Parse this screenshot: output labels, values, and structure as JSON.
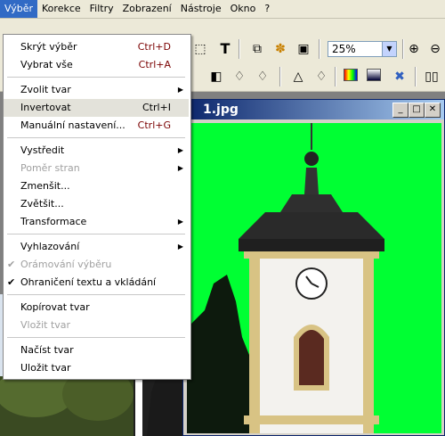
{
  "menubar": {
    "items": [
      "Výběr",
      "Korekce",
      "Filtry",
      "Zobrazení",
      "Nástroje",
      "Okno",
      "?"
    ]
  },
  "toolbar": {
    "zoom_value": "25%"
  },
  "document": {
    "title": "1.jpg"
  },
  "menu": {
    "items": [
      {
        "label": "Skrýt výběr",
        "shortcut": "Ctrl+D"
      },
      {
        "label": "Vybrat vše",
        "shortcut": "Ctrl+A"
      },
      {
        "label": "Zvolit tvar",
        "submenu": true
      },
      {
        "label": "Invertovat",
        "shortcut": "Ctrl+I",
        "highlighted": true
      },
      {
        "label": "Manuální nastavení...",
        "shortcut": "Ctrl+G"
      },
      {
        "label": "Vystředit",
        "submenu": true
      },
      {
        "label": "Poměr stran",
        "submenu": true,
        "disabled": true
      },
      {
        "label": "Zmenšit..."
      },
      {
        "label": "Zvětšit..."
      },
      {
        "label": "Transformace",
        "submenu": true
      },
      {
        "label": "Vyhlazování",
        "submenu": true
      },
      {
        "label": "Orámování výběru",
        "checked": true,
        "disabled": true
      },
      {
        "label": "Ohraničení textu a vkládání",
        "checked": true
      },
      {
        "label": "Kopírovat tvar"
      },
      {
        "label": "Vložit tvar",
        "disabled": true
      },
      {
        "label": "Načíst tvar"
      },
      {
        "label": "Uložit tvar"
      }
    ]
  },
  "colors": {
    "selection_bg": "#00ff33",
    "menu_highlight": "#316ac5",
    "shortcut": "#7a0000"
  },
  "icons": [
    "select-rect-icon",
    "text-tool-icon",
    "layers-icon",
    "effects-icon",
    "window-icon",
    "zoom-in-icon",
    "zoom-out-icon",
    "drop-icon",
    "color-balance-icon",
    "levels-icon",
    "compare-icon"
  ]
}
